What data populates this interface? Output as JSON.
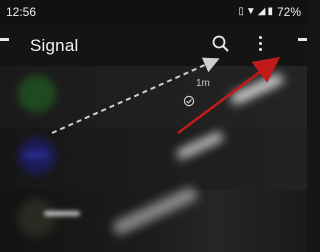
{
  "status_bar": {
    "time": "12:56",
    "battery": "72%",
    "icons": [
      "vibrate-icon",
      "wifi-icon",
      "signal-icon",
      "battery-icon"
    ]
  },
  "app_bar": {
    "title": "Signal",
    "icons": [
      "menu-icon",
      "search-icon",
      "more-options-icon",
      "compose-icon"
    ]
  },
  "conversations": [
    {
      "timestamp": "1m",
      "status_icon": "delivered-check-icon",
      "avatar_color": "#1f4a1f"
    },
    {
      "avatar_color": "#1b1b55"
    },
    {
      "avatar_color": "#2a2a22"
    }
  ],
  "annotations": {
    "arrow_dashed_color": "#cfcfcf",
    "arrow_solid_color": "#c01a1a"
  }
}
